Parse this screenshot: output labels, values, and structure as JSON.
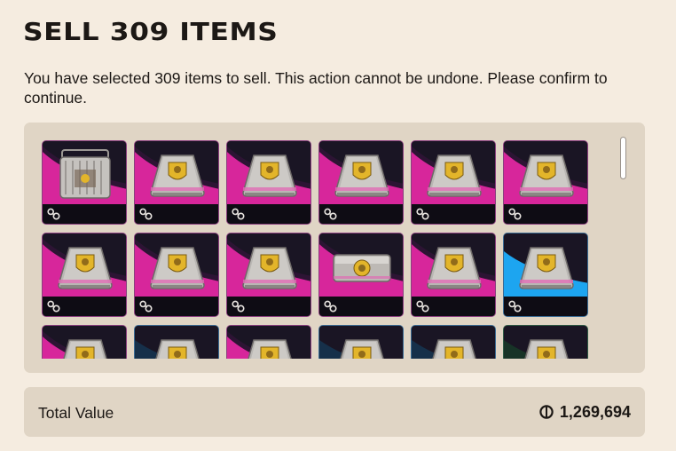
{
  "dialog": {
    "title": "SELL 309 ITEMS",
    "message": "You have selected 309 items to sell. This action cannot be undone. Please confirm to continue."
  },
  "items_grid": {
    "item_icon": "crate-icon",
    "footer_icon": "scrap-icon",
    "items": [
      {
        "crate": "wedge",
        "rarity": "pink",
        "bg": "magenta"
      },
      {
        "crate": "wedge",
        "rarity": "pink",
        "bg": "magenta"
      },
      {
        "crate": "wedge",
        "rarity": "pink",
        "bg": "magenta"
      },
      {
        "crate": "wedge",
        "rarity": "pink",
        "bg": "magenta"
      },
      {
        "crate": "wedge",
        "rarity": "pink",
        "bg": "magenta"
      },
      {
        "crate": "wedge",
        "rarity": "pink",
        "bg": "magenta"
      },
      {
        "crate": "wedge",
        "rarity": "pink",
        "bg": "magenta"
      },
      {
        "crate": "wedge",
        "rarity": "pink",
        "bg": "magenta"
      },
      {
        "crate": "wedge",
        "rarity": "pink",
        "bg": "magenta"
      },
      {
        "crate": "box",
        "rarity": "pink",
        "bg": "magenta"
      },
      {
        "crate": "wedge",
        "rarity": "pink",
        "bg": "magenta"
      },
      {
        "crate": "wedge",
        "rarity": "blue",
        "bg": "cyan"
      },
      {
        "crate": "wedge",
        "rarity": "pink",
        "bg": "magenta"
      },
      {
        "crate": "wedge",
        "rarity": "blue",
        "bg": "dark-blue"
      },
      {
        "crate": "wedge",
        "rarity": "pink",
        "bg": "magenta"
      },
      {
        "crate": "wedge",
        "rarity": "blue",
        "bg": "dark-blue"
      },
      {
        "crate": "wedge",
        "rarity": "blue",
        "bg": "dark-blue"
      },
      {
        "crate": "wedge",
        "rarity": "green",
        "bg": "dark-green"
      }
    ],
    "first_item_crate": "cage"
  },
  "total": {
    "label": "Total Value",
    "value": "1,269,694",
    "currency_icon": "coin-icon"
  },
  "colors": {
    "background": "#f5ece0",
    "panel": "#e0d5c5",
    "magenta": "#d7269b",
    "cyan": "#1da5f0",
    "tile_dark": "#1a1524"
  }
}
